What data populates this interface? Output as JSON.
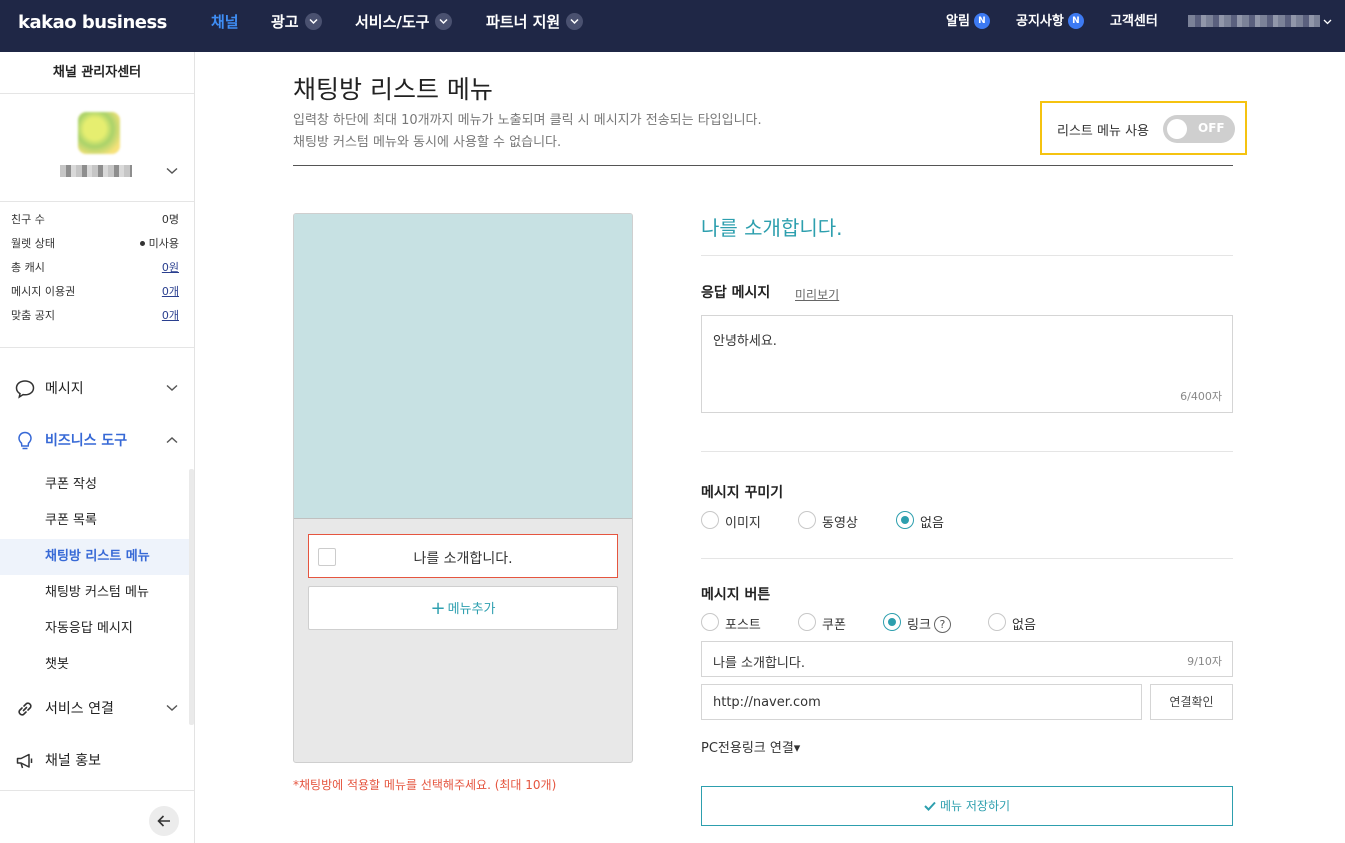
{
  "topbar": {
    "logo": "kakao business",
    "nav": [
      {
        "label": "채널",
        "active": true
      },
      {
        "label": "광고"
      },
      {
        "label": "서비스/도구"
      },
      {
        "label": "파트너 지원"
      }
    ],
    "alarm": "알림",
    "notice": "공지사항",
    "badge": "N",
    "support": "고객센터"
  },
  "sidebar": {
    "title": "채널 관리자센터",
    "stats": [
      {
        "label": "친구 수",
        "value": "0명"
      },
      {
        "label": "월렛 상태",
        "value": "미사용"
      },
      {
        "label": "총 캐시",
        "value": "0원"
      },
      {
        "label": "메시지 이용권",
        "value": "0개"
      },
      {
        "label": "맞춤 공지",
        "value": "0개"
      }
    ],
    "menus": {
      "message": "메시지",
      "biz_tools": "비즈니스 도구",
      "service_link": "서비스 연결",
      "promo": "채널 홍보"
    },
    "submenu": [
      "쿠폰 작성",
      "쿠폰 목록",
      "채팅방 리스트 메뉴",
      "채팅방 커스텀 메뉴",
      "자동응답 메시지",
      "챗봇"
    ]
  },
  "main": {
    "title": "채팅방 리스트 메뉴",
    "desc1": "입력창 하단에 최대 10개까지 메뉴가 노출되며 클릭 시 메시지가 전송되는 타입입니다.",
    "desc2": "채팅방 커스텀 메뉴와 동시에 사용할 수 없습니다.",
    "toggle_label": "리스트 메뉴 사용",
    "toggle_state": "OFF",
    "preview": {
      "menu_item": "나를 소개합니다.",
      "add_menu": "메뉴추가",
      "warning": "*채팅방에 적용할 메뉴를 선택해주세요. (최대 10개)"
    },
    "form": {
      "title": "나를 소개합니다.",
      "response_label": "응답 메시지",
      "preview_link": "미리보기",
      "response_value": "안녕하세요.",
      "response_count": "6/400자",
      "decor_label": "메시지 꾸미기",
      "decor_options": [
        "이미지",
        "동영상",
        "없음"
      ],
      "decor_selected": "없음",
      "button_label": "메시지 버튼",
      "button_options": [
        "포스트",
        "쿠폰",
        "링크",
        "없음"
      ],
      "button_selected": "링크",
      "help_mark": "?",
      "button_name": "나를 소개합니다.",
      "button_name_count": "9/10자",
      "url": "http://naver.com",
      "confirm": "연결확인",
      "pc_link": "PC전용링크 연결▾",
      "save": "메뉴 저장하기"
    }
  },
  "colors": {
    "topbar": "#1f2746",
    "accent_teal": "#2d9fae",
    "active_blue": "#3769d6",
    "highlight": "#f5c310",
    "warning": "#e5553f"
  }
}
